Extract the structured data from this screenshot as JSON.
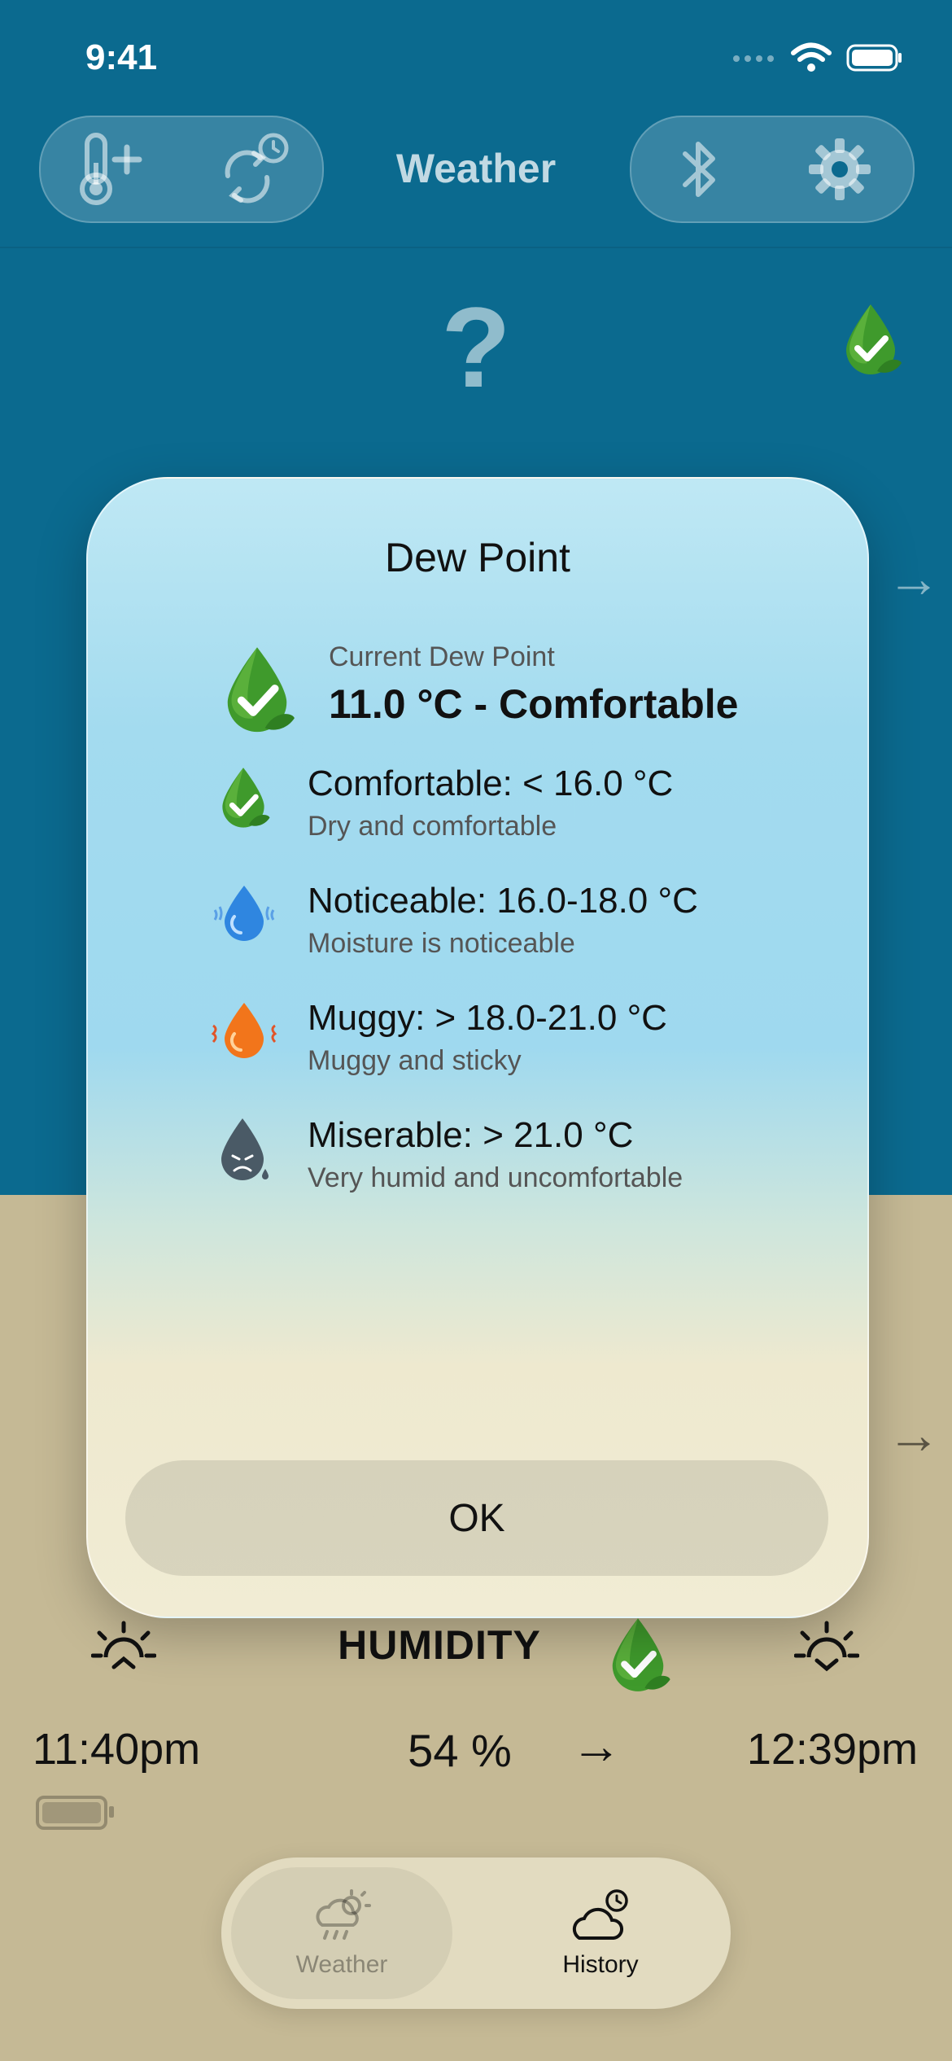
{
  "status_bar": {
    "time": "9:41"
  },
  "nav": {
    "title": "Weather"
  },
  "main": {
    "unknown_symbol": "?"
  },
  "modal": {
    "title": "Dew Point",
    "current_label": "Current Dew Point",
    "current_value": "11.0 °C - Comfortable",
    "levels": [
      {
        "title": "Comfortable: < 16.0 °C",
        "desc": "Dry and comfortable",
        "icon": "green-leaf-drop-check-icon"
      },
      {
        "title": "Noticeable: 16.0-18.0 °C",
        "desc": "Moisture is noticeable",
        "icon": "blue-drop-icon"
      },
      {
        "title": "Muggy: > 18.0-21.0 °C",
        "desc": "Muggy and sticky",
        "icon": "orange-drop-icon"
      },
      {
        "title": "Miserable: > 21.0 °C",
        "desc": "Very humid and uncomfortable",
        "icon": "dark-drop-icon"
      }
    ],
    "ok_label": "OK"
  },
  "humidity": {
    "label": "HUMIDITY",
    "value": "54 %",
    "sunrise_time": "11:40pm",
    "sunset_time": "12:39pm"
  },
  "tabs": [
    {
      "label": "Weather"
    },
    {
      "label": "History"
    }
  ],
  "colors": {
    "top_background": "#0b6a8f",
    "bottom_background": "#c5b995",
    "modal_top": "#bfe8f4",
    "modal_bottom": "#f1ecd4"
  }
}
